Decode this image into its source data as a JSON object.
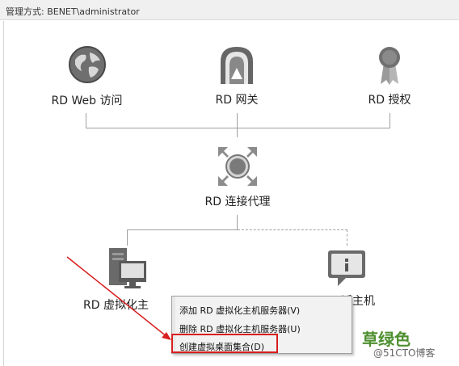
{
  "title": "管理方式: BENET\\administrator",
  "nodes": {
    "web_access": "RD Web 访问",
    "gateway": "RD 网关",
    "licensing": "RD 授权",
    "broker": "RD 连接代理",
    "virt_host": "RD 虚拟化主",
    "session_host": "话主机"
  },
  "context_menu": {
    "items": [
      "添加 RD 虚拟化主机服务器(V)",
      "删除 RD 虚拟化主机服务器(U)",
      "创建虚拟桌面集合(D)"
    ],
    "highlighted_index": 2
  },
  "watermark": {
    "text": "草绿色",
    "source": "@51CTO博客",
    "color": "#4d8f2f"
  },
  "annotation_color": "#d81e1e",
  "icons": [
    "globe-icon",
    "gateway-icon",
    "certificate-icon",
    "broker-icon",
    "server-monitor-icon",
    "session-host-icon"
  ]
}
